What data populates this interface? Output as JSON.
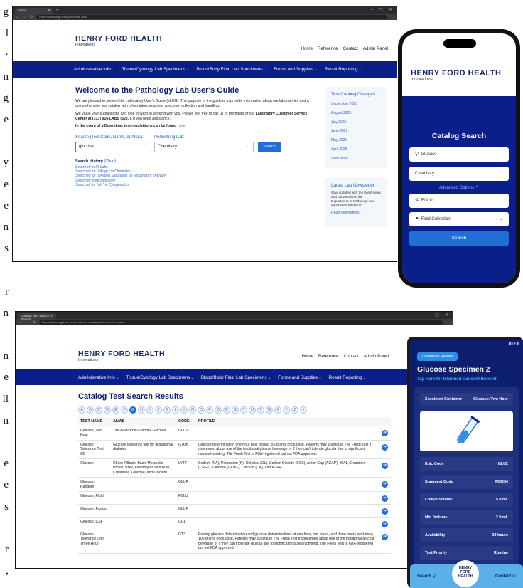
{
  "left_fragment": [
    "g",
    "l",
    "·",
    "n",
    "g",
    "e",
    "",
    "y",
    "e",
    "e",
    "n",
    "s",
    "",
    "r",
    "n",
    "",
    "n",
    "e",
    "ll",
    "n",
    "",
    "e",
    "e",
    "s",
    "",
    "r",
    ","
  ],
  "screen1": {
    "tab_title": "Home",
    "url": "https://pathology.henryfordhealth.com",
    "logo": "HENRY FORD HEALTH",
    "logo_sub": "Innovations",
    "top_nav": [
      "Home",
      "Reference",
      "Contact",
      "Admin Panel"
    ],
    "main_nav": [
      "Administrative Info",
      "Tissue/Cytology Lab Specimens",
      "Blood/Body Fluid Lab Specimens",
      "Forms and Supplies",
      "Result Reporting"
    ],
    "title": "Welcome to the Pathology Lab User's Guide",
    "para1": "We are pleased to present the Laboratory User's Guide (eLUG). The purpose of the guide is to provide information about our laboratories and a comprehensive test catalog with information regarding specimen collection and handling.",
    "para2a": "We value your suggestions and look forward to working with you. Please feel free to call us or members of our ",
    "para2b": "Laboratory Customer Service Center at (313) 916-LABS (5227)",
    "para2c": ", if you need assistance.",
    "para3a": "In the event of a Downtime, test requisitions can be found ",
    "para3b": "here",
    "search_label": "Search (Test Code, Name, or Alias):",
    "perf_label": "Performing Lab:",
    "search_value": "glucose",
    "perf_value": "Chemistry",
    "search_btn": "Search",
    "history_label": "Search History",
    "history_clear": "(Clear)",
    "history": [
      "Searched in All Labs",
      "Searched for \"allergy\" in Chemistry",
      "Searched for \"Oxygen Saturation\" in Respiratory Therapy",
      "Searched in Microbiology",
      "Searched for \"cfn\" in Cytogenetics"
    ],
    "changes_title": "Test Catalog Changes",
    "changes": [
      "September 2025",
      "August 2025",
      "July 2025",
      "June 2025",
      "May 2025",
      "April 2025",
      "View More..."
    ],
    "newsletter_title": "Latest Lab Newsletter",
    "newsletter_text": "Stay updated with the latest news and updates from the Department of Pathology and Laboratory Medicine.",
    "newsletter_link": "Read Newsletters"
  },
  "phone": {
    "logo": "HENRY FORD HEALTH",
    "logo_sub": "Innovations",
    "title": "Catalog Search",
    "search_value": "Glucose",
    "lab_value": "Chemistry",
    "advanced": "Advanced Options",
    "code_value": "FGLU",
    "container_value": "Fluid Collection",
    "button": "Search"
  },
  "screen2": {
    "tab_title": "Catalog Test Search Results",
    "url": "https://pathology.henryfordhealth.com/catalog/test-search-results",
    "logo": "HENRY FORD HEALTH",
    "logo_sub": "Innovations",
    "top_nav": [
      "Home",
      "Reference",
      "Contact",
      "Admin Panel"
    ],
    "main_nav": [
      "Administrative Info",
      "Tissue/Cytology Lab Specimens",
      "Blood/Body Fluid Lab Specimens",
      "Forms and Supplies",
      "Result Reporting"
    ],
    "title": "Catalog Test Search Results",
    "letters": [
      "A",
      "B",
      "C",
      "D",
      "E",
      "F",
      "G",
      "H",
      "I",
      "J",
      "K",
      "L",
      "M",
      "N",
      "O",
      "P",
      "Q",
      "R",
      "S",
      "T",
      "U",
      "V",
      "W",
      "X",
      "Y",
      "Z",
      "#"
    ],
    "active_letter": "G",
    "columns": [
      "TEST NAME",
      "ALIAS",
      "CODE",
      "PROFILE"
    ],
    "rows": [
      {
        "name": "Glucose, Two Hour",
        "alias": "Two-Hour Post-Prandial Glucose",
        "code": "GLU2",
        "profile": ""
      },
      {
        "name": "Glucose Tolerance Test, OB",
        "alias": "Glucose tolerance test for gestational diabetes",
        "code": "GTOB",
        "profile": "Glucose determination one hour post dosing, 50 grams of glucose. Patients may substitute The Fresh Test if concerned about use of the traditional glucola beverage or if they can't tolerate glucola due to significant nausea/vomiting. The Fresh Test is FDA-registered but not FDA approved."
      },
      {
        "name": "Glucose",
        "alias": "Chem 7 Basic, Basic Metabolic Profile, BMP, Electrolytes with BUN, Creatinine, Glucose, and Calcium",
        "code": "LYT7",
        "profile": "Sodium (NA), Potassium (K), Chloride (CL), Carbon Dioxide (CO2), Anion Gap (AGAP), BUN, Creatinine (CRET), Glucose (GLUC), Calcium (CA), and eGFR"
      },
      {
        "name": "Glucose, Random",
        "alias": "",
        "code": "GLUR",
        "profile": ""
      },
      {
        "name": "Glucose, Fluid",
        "alias": "",
        "code": "FGLU",
        "profile": ""
      },
      {
        "name": "Glucose, Fasting",
        "alias": "",
        "code": "GLUF",
        "profile": ""
      },
      {
        "name": "Glucose, CSF",
        "alias": "",
        "code": "CGL",
        "profile": ""
      },
      {
        "name": "Glucose Tolerance Test, Three Hour",
        "alias": "",
        "code": "GT3",
        "profile": "Fasting glucose determination and glucose determinations at one hour, two hours, and three hours post-dose, 100 grams of glucose. Patients may substitute The Fresh Test if concerned about use of the traditional glucola beverage or if they can't tolerate glucola due to significant nausea/vomiting. The Fresh Test is FDA-registered but not FDA approved."
      }
    ]
  },
  "android": {
    "back": "Return to Results",
    "title": "Glucose Specimen 2",
    "consent": "Tap Here for Informed Consent Booklet",
    "container_label": "Specimen Container",
    "container_value": "Glucose: Two Hour",
    "details": [
      {
        "label": "Epic Code",
        "value": "GLU2"
      },
      {
        "label": "Sunquest Code",
        "value": "A53234"
      },
      {
        "label": "Collect Volume",
        "value": "5.0 mL"
      },
      {
        "label": "Min. Volume",
        "value": "2.0 mL"
      },
      {
        "label": "Availability",
        "value": "24 hours"
      },
      {
        "label": "Test Priority",
        "value": "Routine"
      }
    ],
    "nav_search": "Search",
    "nav_logo": [
      "HENRY",
      "FORD",
      "HEALTH"
    ],
    "nav_contact": "Contact"
  },
  "colors": {
    "navy": "#0b1f8a",
    "brand": "#1b2a6b",
    "accent": "#1f6fd6",
    "app_bg": "#0d1e6e",
    "bottom_bar": "#5ab0e8"
  }
}
